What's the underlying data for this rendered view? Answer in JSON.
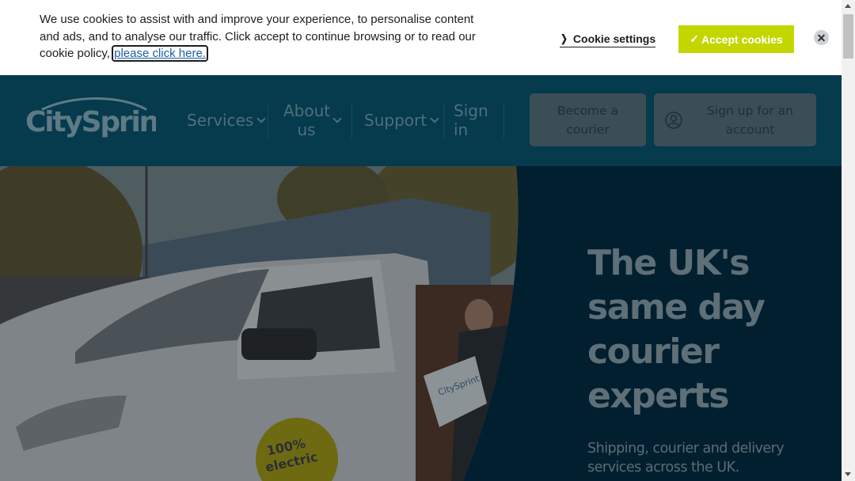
{
  "cookie_banner": {
    "text": "We use cookies to assist with and improve your experience, to personalise content and ads, and to analyse our traffic. Click accept to continue browsing or to read our cookie policy,",
    "policy_link": "please click here.",
    "settings_label": "Cookie settings",
    "accept_label": "Accept cookies",
    "accept_check": "✓",
    "close_symbol": "✕"
  },
  "header": {
    "logo_text": "CitySprint",
    "nav": [
      {
        "label": "Services",
        "has_dropdown": true
      },
      {
        "label": "About us",
        "has_dropdown": true
      },
      {
        "label": "Support",
        "has_dropdown": true
      },
      {
        "label": "Sign in",
        "has_dropdown": false
      }
    ],
    "become_courier_label": "Become a courier",
    "signup_label": "Sign up for an account",
    "signup_icon": "user-circle-icon"
  },
  "hero": {
    "title": "The UK's same day courier experts",
    "subtitle": "Shipping, courier and delivery services across the UK.",
    "photo_alt": "Courier loading a CitySprint parcel into a white electric van",
    "van_badge": "100% electric",
    "parcel_logo": "CitySprint"
  },
  "colors": {
    "header_bg": "#063a4d",
    "hero_bg": "#021f30",
    "accept_bg": "#c4d600",
    "overlay_text": "#5e6f77"
  }
}
